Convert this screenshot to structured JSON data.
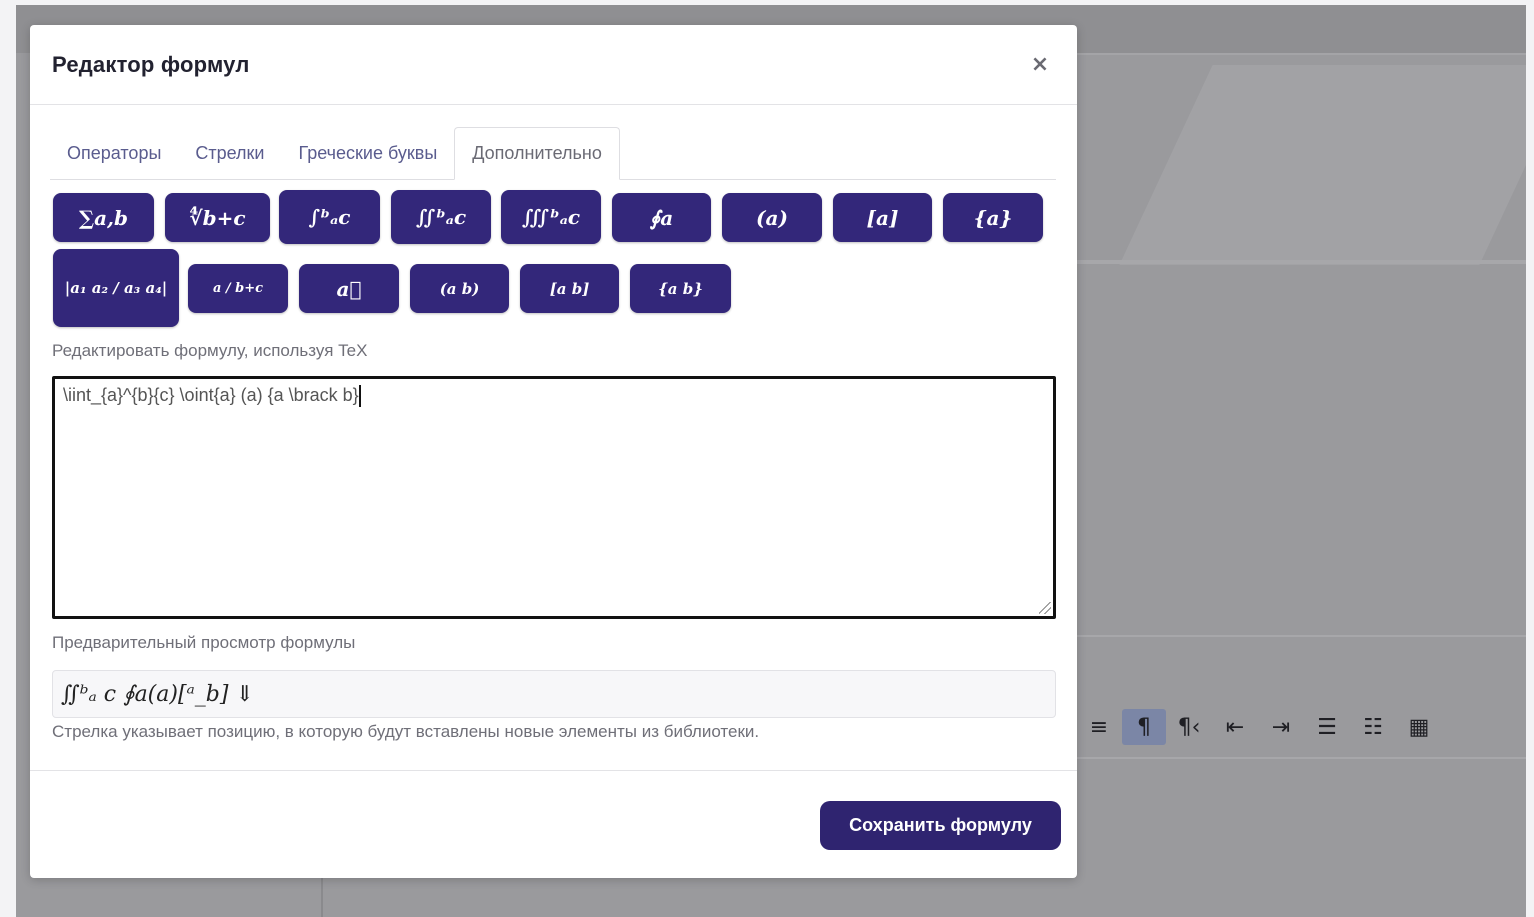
{
  "modal": {
    "title": "Редактор формул",
    "close_glyph": "×"
  },
  "tabs": [
    {
      "label": "Операторы",
      "active": false
    },
    {
      "label": "Стрелки",
      "active": false
    },
    {
      "label": "Греческие буквы",
      "active": false
    },
    {
      "label": "Дополнительно",
      "active": true
    }
  ],
  "symbol_buttons_row1": [
    {
      "name": "sum-button",
      "glyph": "∑a,b"
    },
    {
      "name": "root-button",
      "glyph": "∜b+c"
    },
    {
      "name": "integral-button",
      "glyph": "∫ᵇₐc"
    },
    {
      "name": "double-integral-button",
      "glyph": "∬ᵇₐc"
    },
    {
      "name": "triple-integral-button",
      "glyph": "∭ᵇₐc"
    },
    {
      "name": "contour-integral-button",
      "glyph": "∮a"
    },
    {
      "name": "parentheses-button",
      "glyph": "(a)"
    },
    {
      "name": "brackets-button",
      "glyph": "[a]"
    },
    {
      "name": "braces-button",
      "glyph": "{a}"
    }
  ],
  "symbol_buttons_row2": [
    {
      "name": "determinant-button",
      "glyph": "|a₁ a₂ / a₃ a₄|"
    },
    {
      "name": "fraction-button",
      "glyph": "a / b+c"
    },
    {
      "name": "vector-button",
      "glyph": "a⃗"
    },
    {
      "name": "binom-paren-button",
      "glyph": "(a b)"
    },
    {
      "name": "binom-bracket-button",
      "glyph": "[a b]"
    },
    {
      "name": "binom-brace-button",
      "glyph": "{a b}"
    }
  ],
  "tex_editor": {
    "label": "Редактировать формулу, используя TeX",
    "value": "\\iint_{a}^{b}{c} \\oint{a} (a) {a \\brack b}"
  },
  "preview": {
    "label": "Предварительный просмотр формулы",
    "rendered": "∬ᵇₐ c ∮a(a)[ᵃ_b] ⇓"
  },
  "hint": "Стрелка указывает позицию, в которую будут вставлены новые элементы из библиотеки.",
  "save_button": "Сохранить формулу",
  "background_toolbar": [
    "≡",
    "¶",
    "¶‹",
    "⇤",
    "⇥",
    "☰",
    "☷",
    "▦"
  ]
}
